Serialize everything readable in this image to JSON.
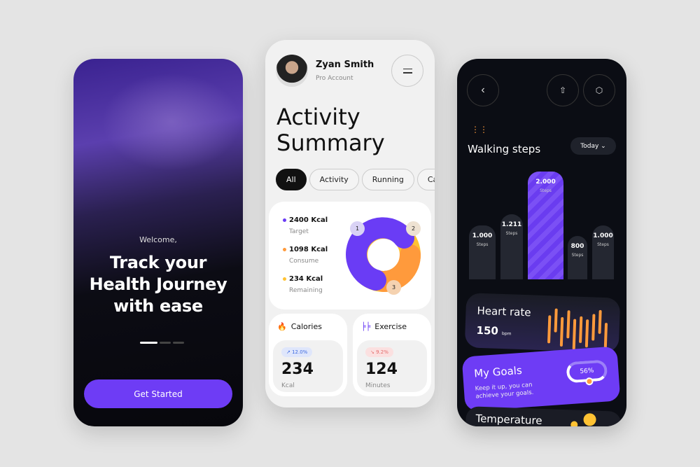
{
  "onboarding": {
    "welcome": "Welcome,",
    "title_lines": [
      "Track your",
      "Health Journey",
      "with ease"
    ],
    "cta": "Get Started",
    "page_indicator": {
      "pages": 3,
      "current": 1
    }
  },
  "summary": {
    "user": {
      "name": "Zyan Smith",
      "plan": "Pro Account"
    },
    "title_lines": [
      "Activity",
      "Summary"
    ],
    "filters": [
      {
        "label": "All",
        "active": true
      },
      {
        "label": "Activity"
      },
      {
        "label": "Running"
      },
      {
        "label": "Cal"
      }
    ],
    "calories_chart": {
      "legend": [
        {
          "value": "2400 Kcal",
          "label": "Target",
          "color": "#6a3cf5"
        },
        {
          "value": "1098 Kcal",
          "label": "Consume",
          "color": "#ff9a3c"
        },
        {
          "value": "234 Kcal",
          "label": "Remaining",
          "color": "#ffc233"
        }
      ],
      "markers": [
        "1",
        "2",
        "3"
      ]
    },
    "calories": {
      "title": "Calories",
      "change": "12.0%",
      "trend": "up",
      "value": "234",
      "unit": "Kcal"
    },
    "exercise": {
      "title": "Exercise",
      "change": "9.2%",
      "trend": "down",
      "value": "124",
      "unit": "Minutes"
    }
  },
  "steps": {
    "title": "Walking steps",
    "period": "Today",
    "bars": [
      {
        "value": "1.000",
        "unit": "Steps",
        "n": 1000
      },
      {
        "value": "1.211",
        "unit": "Steps",
        "n": 1211
      },
      {
        "value": "2.000",
        "unit": "Steps",
        "n": 2000,
        "highlight": true
      },
      {
        "value": "800",
        "unit": "Steps",
        "n": 800
      },
      {
        "value": "1.000",
        "unit": "Steps",
        "n": 1000
      }
    ],
    "heart": {
      "title": "Heart rate",
      "value": "150",
      "unit": "bpm"
    },
    "goals": {
      "title": "My Goals",
      "text": "Keep it up, you can achieve your goals.",
      "progress": "56%"
    },
    "temperature": {
      "title": "Temperature"
    },
    "colors": {
      "accent": "#6e3cf5",
      "orange": "#ff9a3c"
    }
  }
}
